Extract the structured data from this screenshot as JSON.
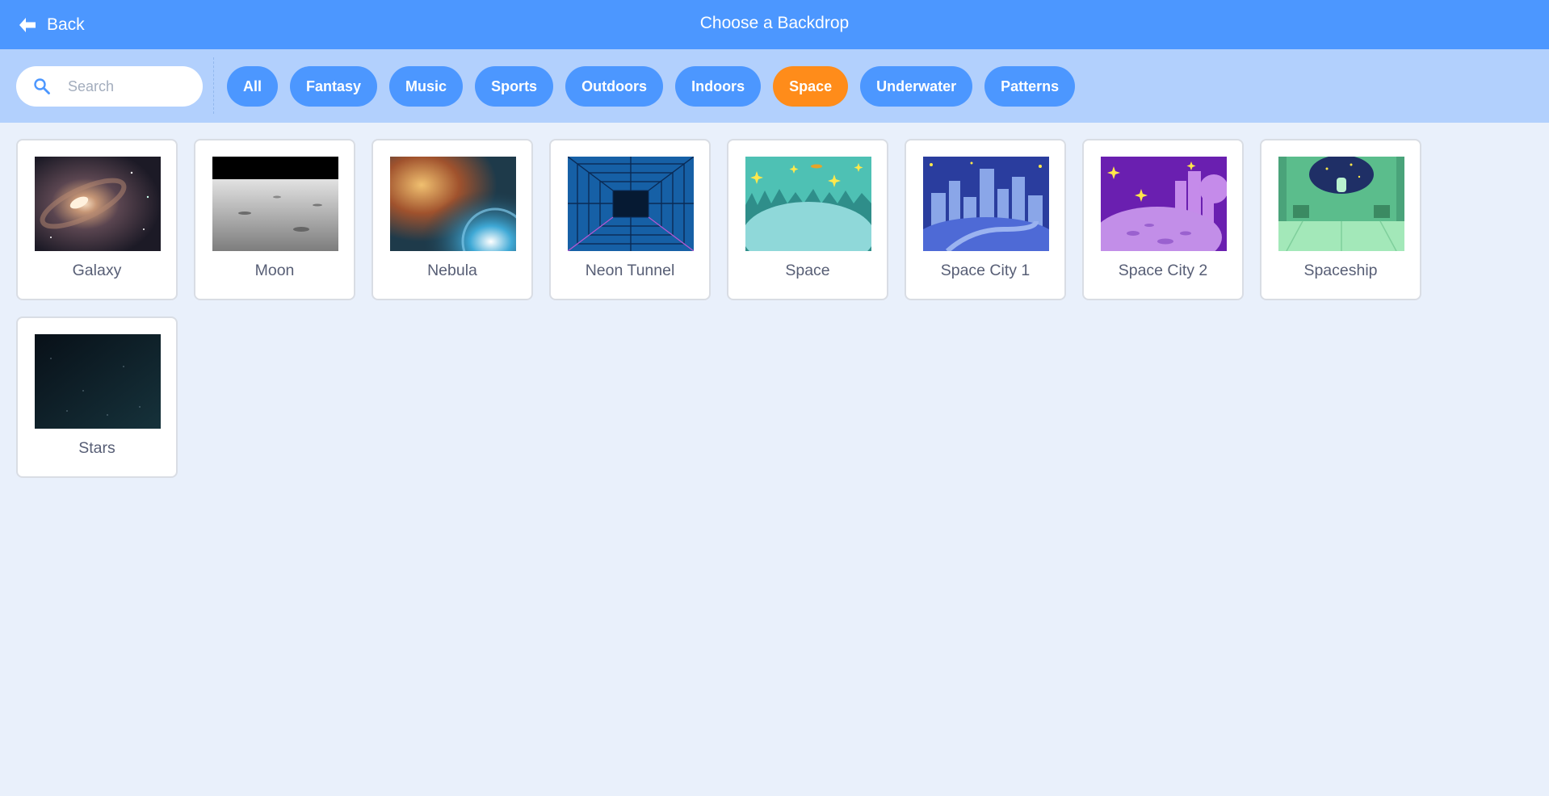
{
  "header": {
    "back_label": "Back",
    "title": "Choose a Backdrop"
  },
  "search": {
    "placeholder": "Search",
    "value": ""
  },
  "categories": [
    {
      "label": "All",
      "active": false
    },
    {
      "label": "Fantasy",
      "active": false
    },
    {
      "label": "Music",
      "active": false
    },
    {
      "label": "Sports",
      "active": false
    },
    {
      "label": "Outdoors",
      "active": false
    },
    {
      "label": "Indoors",
      "active": false
    },
    {
      "label": "Space",
      "active": true
    },
    {
      "label": "Underwater",
      "active": false
    },
    {
      "label": "Patterns",
      "active": false
    }
  ],
  "backdrops": [
    {
      "name": "Galaxy",
      "thumb": "galaxy"
    },
    {
      "name": "Moon",
      "thumb": "moon"
    },
    {
      "name": "Nebula",
      "thumb": "nebula"
    },
    {
      "name": "Neon Tunnel",
      "thumb": "neon-tunnel"
    },
    {
      "name": "Space",
      "thumb": "space"
    },
    {
      "name": "Space City 1",
      "thumb": "space-city-1"
    },
    {
      "name": "Space City 2",
      "thumb": "space-city-2"
    },
    {
      "name": "Spaceship",
      "thumb": "spaceship"
    },
    {
      "name": "Stars",
      "thumb": "stars"
    }
  ],
  "colors": {
    "header": "#4c97ff",
    "filterbar": "#b2d0fd",
    "background": "#e9f0fb",
    "active_chip": "#ff8c1a",
    "chip": "#4c97ff",
    "label_text": "#575e75"
  }
}
